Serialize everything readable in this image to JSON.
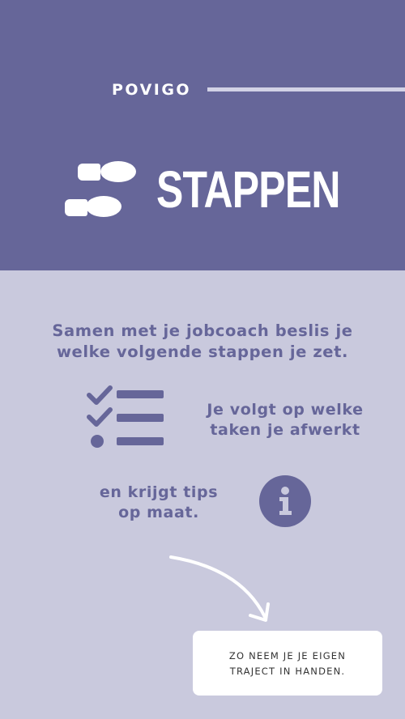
{
  "brand": {
    "name": "POVIGO"
  },
  "header": {
    "title": "STAPPEN",
    "icon": "footsteps-icon"
  },
  "intro": {
    "line1": "Samen met je jobcoach beslis je",
    "line2": "welke volgende stappen je zet."
  },
  "follow_up": {
    "icon": "checklist-icon",
    "line1": "Je volgt op welke",
    "line2": "taken je afwerkt"
  },
  "tips": {
    "icon": "info-icon",
    "line1": "en krijgt tips",
    "line2": "op maat."
  },
  "callout": {
    "icon": "curved-arrow-icon",
    "line1": "ZO NEEM JE JE EIGEN",
    "line2": "TRAJECT IN HANDEN."
  },
  "colors": {
    "primary": "#666699",
    "background_light": "#c9c9dd",
    "brand_line": "#d2d2e6",
    "card": "#ffffff",
    "card_text": "#333333"
  }
}
